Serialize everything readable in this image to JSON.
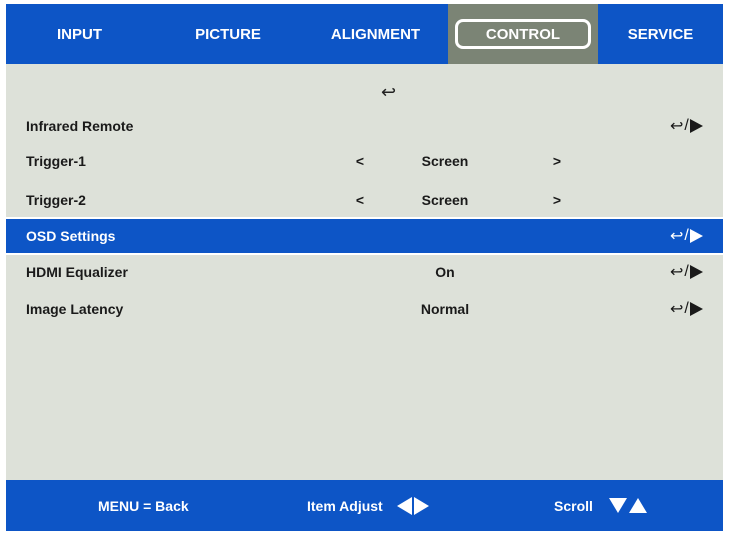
{
  "tabs": [
    {
      "label": "INPUT",
      "active": false
    },
    {
      "label": "PICTURE",
      "active": false
    },
    {
      "label": "ALIGNMENT",
      "active": false
    },
    {
      "label": "CONTROL",
      "active": true
    },
    {
      "label": "SERVICE",
      "active": false
    }
  ],
  "menu": {
    "return_symbol": "↩",
    "items": [
      {
        "label": "Infrared Remote",
        "prev": "",
        "value": "",
        "next": "",
        "enter_icon": "return-submenu-icon",
        "selected": false
      },
      {
        "label": "Trigger-1",
        "prev": "<",
        "value": "Screen",
        "next": ">",
        "enter_icon": "",
        "selected": false
      },
      {
        "label": "Trigger-2",
        "prev": "<",
        "value": "Screen",
        "next": ">",
        "enter_icon": "",
        "selected": false
      },
      {
        "label": "OSD Settings",
        "prev": "",
        "value": "",
        "next": "",
        "enter_icon": "return-submenu-icon",
        "selected": true
      },
      {
        "label": "HDMI Equalizer",
        "prev": "",
        "value": "On",
        "next": "",
        "enter_icon": "return-submenu-icon",
        "selected": false
      },
      {
        "label": "Image Latency",
        "prev": "",
        "value": "Normal",
        "next": "",
        "enter_icon": "return-submenu-icon",
        "selected": false
      }
    ],
    "enter_return_glyph": "↩",
    "enter_slash": "/"
  },
  "footer": {
    "back_hint": "MENU = Back",
    "adjust_hint": "Item Adjust",
    "scroll_hint": "Scroll"
  },
  "colors": {
    "accent_blue": "#0d55c6",
    "active_tab": "#7b8475",
    "panel_bg": "#dde1d9"
  }
}
